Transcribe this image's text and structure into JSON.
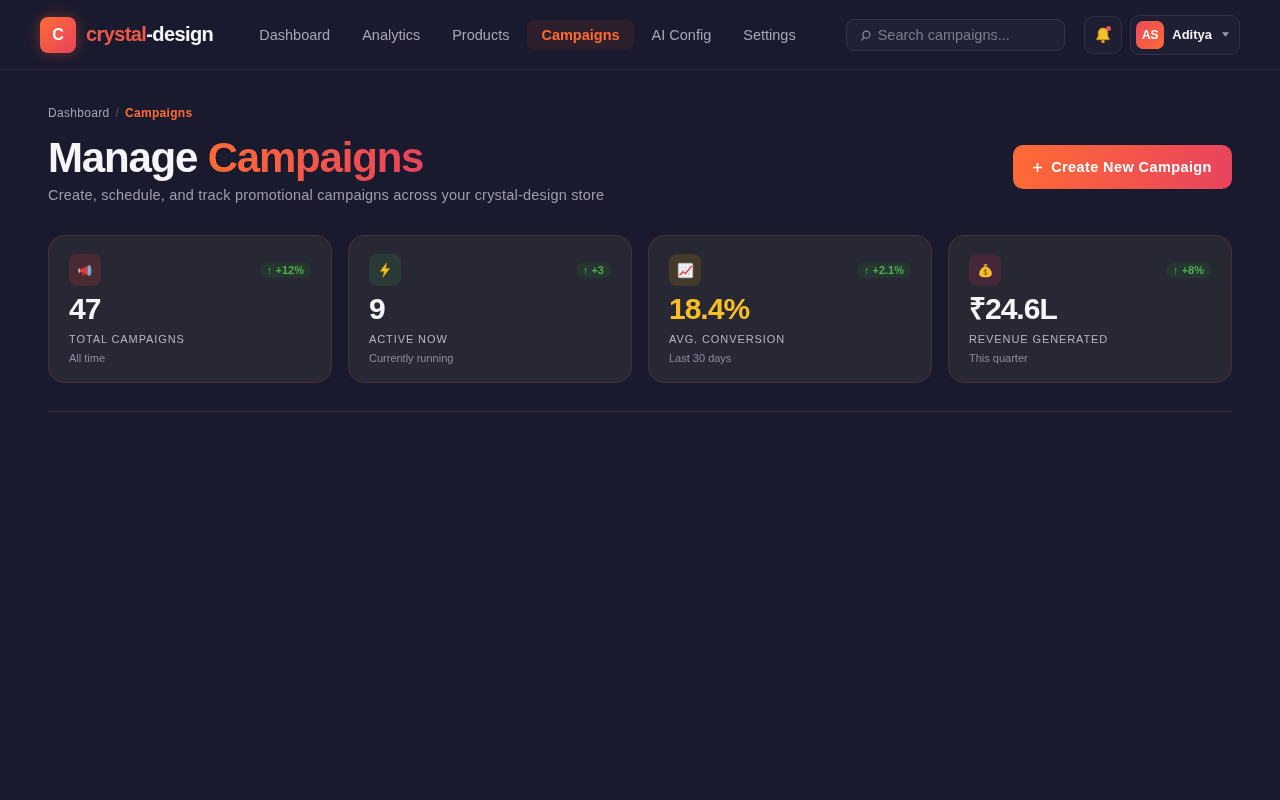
{
  "brand": {
    "mark": "C",
    "name_lead": "crystal",
    "name_rest": "-design"
  },
  "nav": [
    {
      "label": "Dashboard",
      "selected": false
    },
    {
      "label": "Analytics",
      "selected": false
    },
    {
      "label": "Products",
      "selected": false
    },
    {
      "label": "Campaigns",
      "selected": true
    },
    {
      "label": "AI Config",
      "selected": false
    },
    {
      "label": "Settings",
      "selected": false
    }
  ],
  "search": {
    "placeholder": "Search campaigns..."
  },
  "notifications": {
    "unread": true
  },
  "user": {
    "initials": "AS",
    "name": "Aditya"
  },
  "breadcrumb": {
    "separator": "/",
    "items": [
      {
        "label": "Dashboard",
        "current": false
      },
      {
        "label": "Campaigns",
        "current": true
      }
    ]
  },
  "page": {
    "title_lead": "Manage",
    "title_accent": "Campaigns",
    "subtitle": "Create, schedule, and track promotional campaigns across your crystal-design store",
    "action": "Create New Campaign"
  },
  "stats": [
    {
      "kind": "megaphone",
      "change": "↑ +12%",
      "value": "47",
      "highlighted": false,
      "label": "TOTAL CAMPAIGNS",
      "note": "All time"
    },
    {
      "kind": "bolt",
      "change": "↑ +3",
      "value": "9",
      "highlighted": false,
      "label": "ACTIVE NOW",
      "note": "Currently running"
    },
    {
      "kind": "chart",
      "change": "↑ +2.1%",
      "value": "18.4%",
      "highlighted": true,
      "label": "AVG. CONVERSION",
      "note": "Last 30 days"
    },
    {
      "kind": "moneybag",
      "change": "↑ +8%",
      "value": "₹24.6L",
      "highlighted": false,
      "label": "REVENUE GENERATED",
      "note": "This quarter"
    }
  ]
}
